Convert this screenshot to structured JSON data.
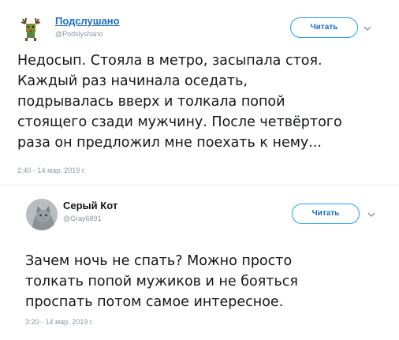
{
  "tweets": [
    {
      "author_name": "Подслушано",
      "author_handle": "@Podslyshano",
      "follow_label": "Читать",
      "text_lines": [
        "Недосып. Стояла в метро, засыпала стоя.",
        "Каждый раз начинала оседать,",
        "подрывалась вверх и толкала попой",
        "стоящего сзади мужчину. После четвёртого",
        "раза он предложил мне поехать к нему..."
      ],
      "timestamp": "2:40 - 14 мар. 2019 г."
    },
    {
      "author_name": "Серый Кот",
      "author_handle": "@Gray6891",
      "follow_label": "Читать",
      "text_lines": [
        "Зачем ночь не спать? Можно просто",
        "толкать попой мужиков и не бояться",
        "проспать потом самое интересное."
      ],
      "timestamp": "3:20 - 14 мар. 2019 г."
    }
  ],
  "colors": {
    "link_blue": "#1b6fbe",
    "button_border": "#1da1f2",
    "muted_text": "#8a98a4",
    "divider": "#e6ecf0"
  },
  "icons": {
    "tweet1_avatar": "reindeer-avatar-icon",
    "tweet2_avatar": "cat-avatar-icon",
    "caret": "chevron-down-icon"
  }
}
